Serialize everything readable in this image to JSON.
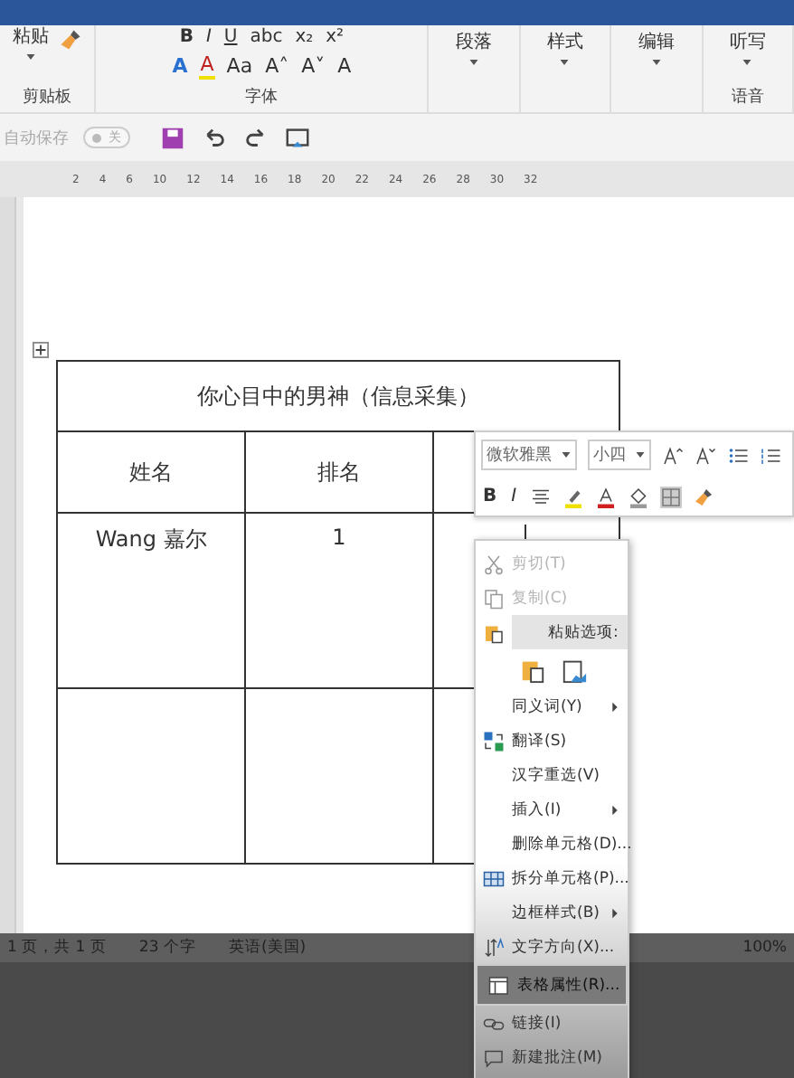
{
  "ribbon": {
    "paste_label": "粘贴",
    "clipboard_group": "剪贴板",
    "font_row1": [
      "B",
      "I",
      "U",
      "abc",
      "x₂",
      "x²"
    ],
    "font_row2": [
      "A",
      "A",
      "Aa",
      "A˄",
      "A˅",
      "A"
    ],
    "font_group": "字体",
    "groups": [
      {
        "label": "段落"
      },
      {
        "label": "样式"
      },
      {
        "label": "编辑"
      },
      {
        "label": "听写"
      }
    ],
    "voice_group": "语音"
  },
  "quick_access": {
    "autosave_label": "自动保存",
    "autosave": {
      "on": false,
      "label": "关"
    }
  },
  "ruler": {
    "ticks": [
      "2",
      "4",
      "6",
      "10",
      "12",
      "14",
      "16",
      "18",
      "20",
      "22",
      "24",
      "26",
      "28",
      "30",
      "32"
    ]
  },
  "table": {
    "title": "你心目中的男神（信息采集）",
    "columns": [
      "姓名",
      "排名"
    ],
    "rows": [
      [
        "Wang 嘉尔",
        "1"
      ]
    ]
  },
  "mini_toolbar": {
    "font": "微软雅黑",
    "size": "小四",
    "buttons": [
      "B",
      "I"
    ]
  },
  "context_menu": {
    "items": [
      {
        "kind": "item",
        "label": "剪切(T)",
        "disabled": true,
        "selected": false,
        "submenu": false
      },
      {
        "kind": "item",
        "label": "复制(C)",
        "disabled": true,
        "selected": false,
        "submenu": false
      },
      {
        "kind": "header",
        "label": "粘贴选项:",
        "disabled": false,
        "selected": false,
        "submenu": false
      },
      {
        "kind": "paste"
      },
      {
        "kind": "item",
        "label": "同义词(Y)",
        "disabled": false,
        "selected": false,
        "submenu": true
      },
      {
        "kind": "item",
        "label": "翻译(S)",
        "disabled": false,
        "selected": false,
        "submenu": false
      },
      {
        "kind": "item",
        "label": "汉字重选(V)",
        "disabled": false,
        "selected": false,
        "submenu": false
      },
      {
        "kind": "item",
        "label": "插入(I)",
        "disabled": false,
        "selected": false,
        "submenu": true
      },
      {
        "kind": "item",
        "label": "删除单元格(D)...",
        "disabled": false,
        "selected": false,
        "submenu": false
      },
      {
        "kind": "item",
        "label": "拆分单元格(P)...",
        "disabled": false,
        "selected": false,
        "submenu": false
      },
      {
        "kind": "item",
        "label": "边框样式(B)",
        "disabled": false,
        "selected": false,
        "submenu": true
      },
      {
        "kind": "item",
        "label": "文字方向(X)...",
        "disabled": false,
        "selected": false,
        "submenu": false
      },
      {
        "kind": "item",
        "label": "表格属性(R)...",
        "disabled": false,
        "selected": true,
        "submenu": false
      },
      {
        "kind": "item",
        "label": "链接(I)",
        "disabled": false,
        "selected": false,
        "submenu": false
      },
      {
        "kind": "item",
        "label": "新建批注(M)",
        "disabled": false,
        "selected": false,
        "submenu": false
      }
    ]
  },
  "status_bar": {
    "page": "1 页，共 1 页",
    "words": "23 个字",
    "language": "英语(美国)",
    "zoom": "100%"
  }
}
